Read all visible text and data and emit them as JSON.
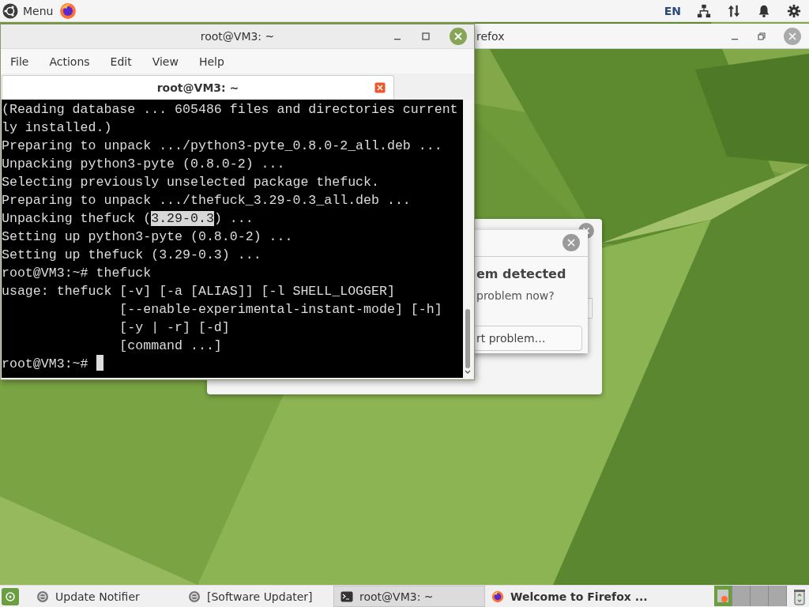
{
  "top_panel": {
    "menu_label": "Menu",
    "language": "EN"
  },
  "firefox_window": {
    "title": "refox"
  },
  "problem_dialog": {
    "heading": "em detected",
    "question": "problem now?",
    "button": "rt problem…"
  },
  "terminal": {
    "title": "root@VM3: ~",
    "menu": [
      "File",
      "Actions",
      "Edit",
      "View",
      "Help"
    ],
    "tab": {
      "label": "root@VM3: ~",
      "selected": true
    },
    "lines": [
      [
        {
          "text": "(Reading database ... 605486 files and directories current",
          "selected": false
        }
      ],
      [
        {
          "text": "ly installed.)",
          "selected": false
        }
      ],
      [
        {
          "text": "Preparing to unpack .../python3-pyte_0.8.0-2_all.deb ...",
          "selected": false
        }
      ],
      [
        {
          "text": "Unpacking python3-pyte (0.8.0-2) ...",
          "selected": false
        }
      ],
      [
        {
          "text": "Selecting previously unselected package thefuck.",
          "selected": false
        }
      ],
      [
        {
          "text": "Preparing to unpack .../thefuck_3.29-0.3_all.deb ...",
          "selected": false
        }
      ],
      [
        {
          "text": "Unpacking thefuck (",
          "selected": false
        },
        {
          "text": "3.29-0.3",
          "selected": true
        },
        {
          "text": ") ...",
          "selected": false
        }
      ],
      [
        {
          "text": "Setting up python3-pyte (0.8.0-2) ...",
          "selected": false
        }
      ],
      [
        {
          "text": "Setting up thefuck (3.29-0.3) ...",
          "selected": false
        }
      ],
      [
        {
          "text": "root@VM3:~# thefuck",
          "selected": false
        }
      ],
      [
        {
          "text": "usage: thefuck [-v] [-a [ALIAS]] [-l SHELL_LOGGER]",
          "selected": false
        }
      ],
      [
        {
          "text": "               [--enable-experimental-instant-mode] [-h]",
          "selected": false
        }
      ],
      [
        {
          "text": "               [-y | -r] [-d]",
          "selected": false
        }
      ],
      [
        {
          "text": "               [command ...]",
          "selected": false
        }
      ],
      [
        {
          "text": "root@VM3:~# ",
          "selected": false
        }
      ]
    ]
  },
  "taskbar": {
    "items": [
      {
        "kind": "notifier",
        "label": "Update Notifier",
        "selected": false,
        "attention": false
      },
      {
        "kind": "notifier",
        "label": "[Software Updater]",
        "selected": false,
        "attention": false
      },
      {
        "kind": "terminal",
        "label": "root@VM3: ~",
        "selected": true,
        "attention": false
      },
      {
        "kind": "firefox",
        "label": "Welcome to Firefox ...",
        "selected": false,
        "attention": true
      }
    ],
    "workspaces": [
      {
        "selected": true
      },
      {
        "selected": false
      },
      {
        "selected": false
      },
      {
        "selected": false
      }
    ]
  }
}
